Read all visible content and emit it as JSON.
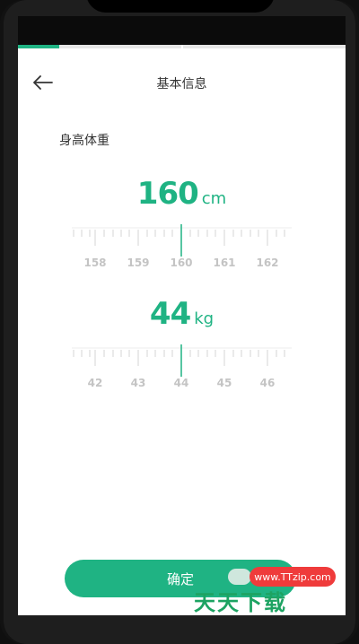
{
  "header": {
    "title": "基本信息",
    "back_icon": "arrow-left-icon"
  },
  "progress": {
    "fraction": 0.125,
    "steps": 2,
    "active_color": "#1fb383"
  },
  "section": {
    "label": "身高体重"
  },
  "height": {
    "value": "160",
    "unit": "cm",
    "tick_labels": [
      "158",
      "159",
      "160",
      "161",
      "162"
    ]
  },
  "weight": {
    "value": "44",
    "unit": "kg",
    "tick_labels": [
      "42",
      "43",
      "44",
      "45",
      "46"
    ]
  },
  "confirm": {
    "label": "确定"
  },
  "watermark": {
    "url": "www.TTzip.com",
    "brand": "天天下载"
  },
  "colors": {
    "accent": "#1fb383",
    "tick_label": "#c4c4c4"
  }
}
